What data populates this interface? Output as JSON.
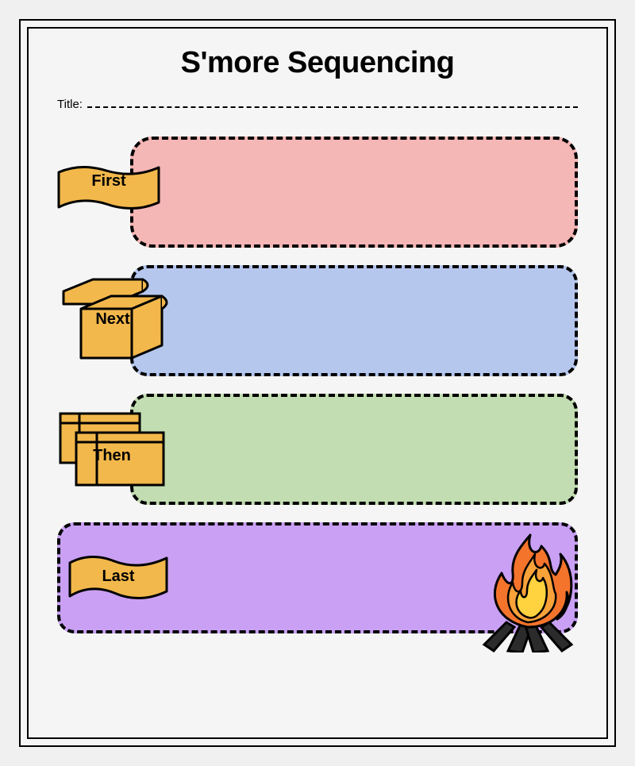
{
  "worksheet": {
    "title": "S'more Sequencing",
    "title_field_label": "Title:",
    "steps": [
      {
        "label": "First",
        "color": "#f5b6b6"
      },
      {
        "label": "Next",
        "color": "#b6c7ee"
      },
      {
        "label": "Then",
        "color": "#c2ddb2"
      },
      {
        "label": "Last",
        "color": "#c9a0f3"
      }
    ],
    "icons": {
      "fire": "campfire-icon"
    }
  }
}
